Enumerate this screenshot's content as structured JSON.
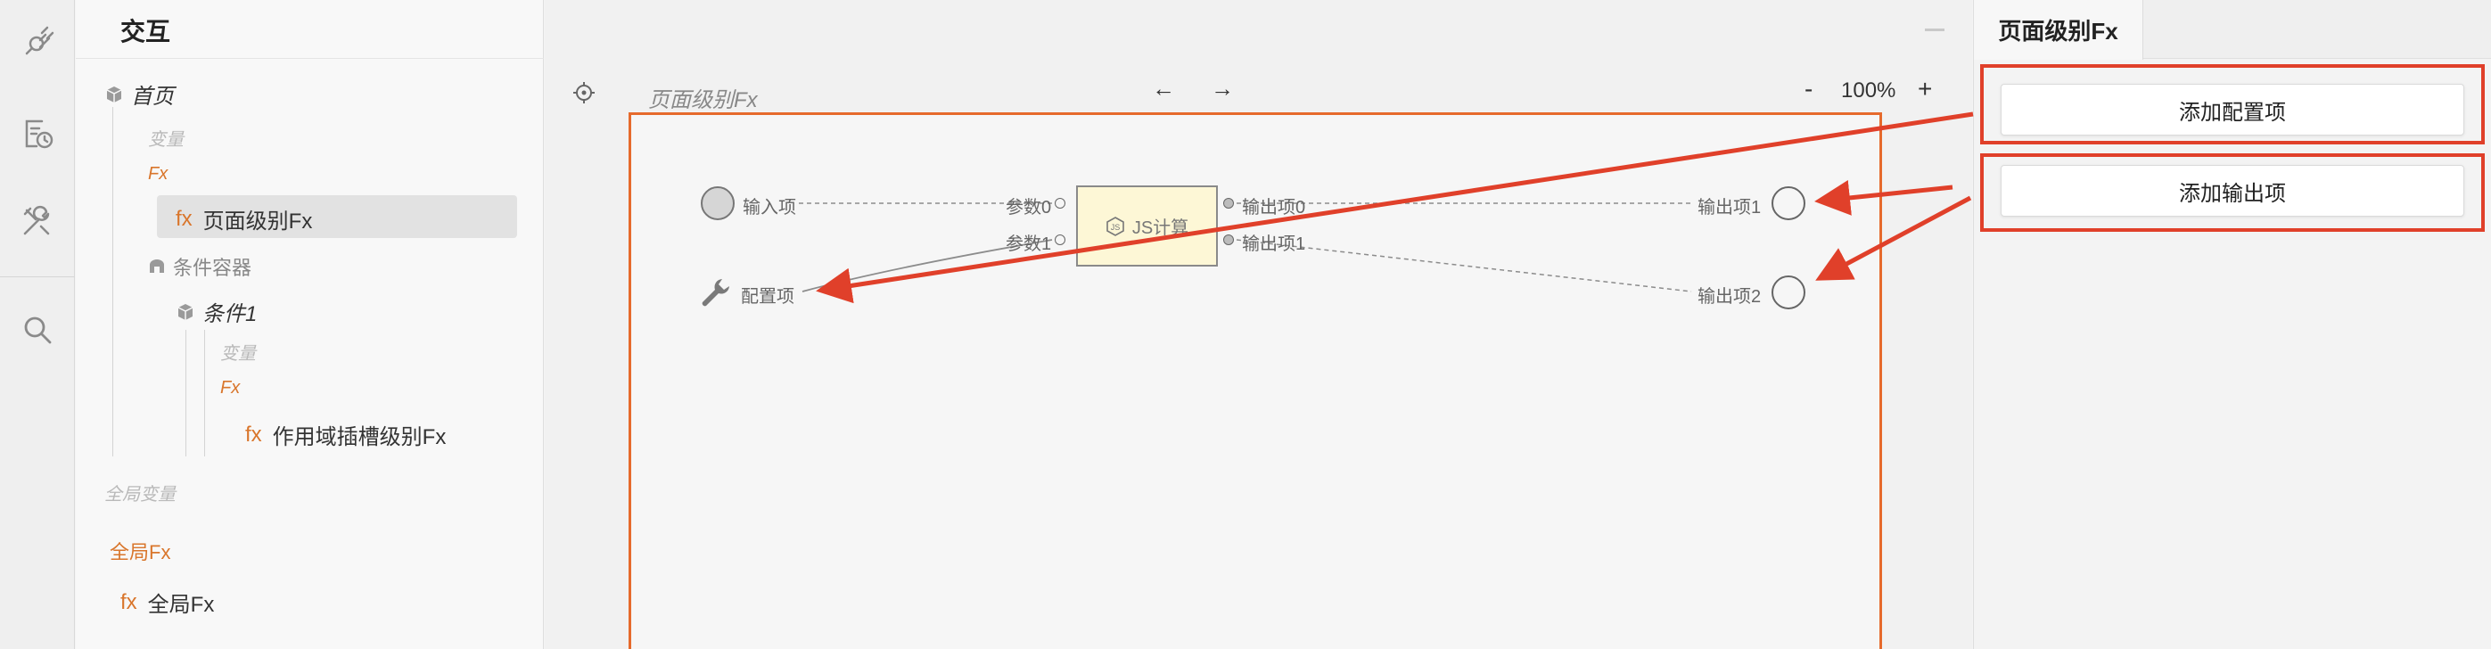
{
  "panel": {
    "title": "交互"
  },
  "tree": {
    "home": "首页",
    "vars_label": "变量",
    "fx_label": "Fx",
    "page_fx": "页面级别Fx",
    "condition_container": "条件容器",
    "condition1": "条件1",
    "sub_vars_label": "变量",
    "sub_fx_label": "Fx",
    "scope_fx": "作用域插槽级别Fx",
    "global_vars": "全局变量",
    "global_fx_label": "全局Fx",
    "global_fx_item": "全局Fx",
    "fx_tag": "fx"
  },
  "canvas": {
    "label": "页面级别Fx",
    "back_arrow": "←",
    "forward_arrow": "→",
    "zoom_out": "-",
    "zoom_level": "100%",
    "zoom_in": "+",
    "input_item": "输入项",
    "config_item": "配置项",
    "param0": "参数0",
    "param1": "参数1",
    "js_node": "JS计算",
    "output0": "输出项0",
    "output1": "输出项1",
    "out_item1": "输出项1",
    "out_item2": "输出项2"
  },
  "right_panel": {
    "tab": "页面级别Fx",
    "add_config": "添加配置项",
    "add_output": "添加输出项"
  },
  "colors": {
    "accent_orange": "#d9762c",
    "frame_border": "#e66a2c",
    "annotation_red": "#e0402a"
  }
}
